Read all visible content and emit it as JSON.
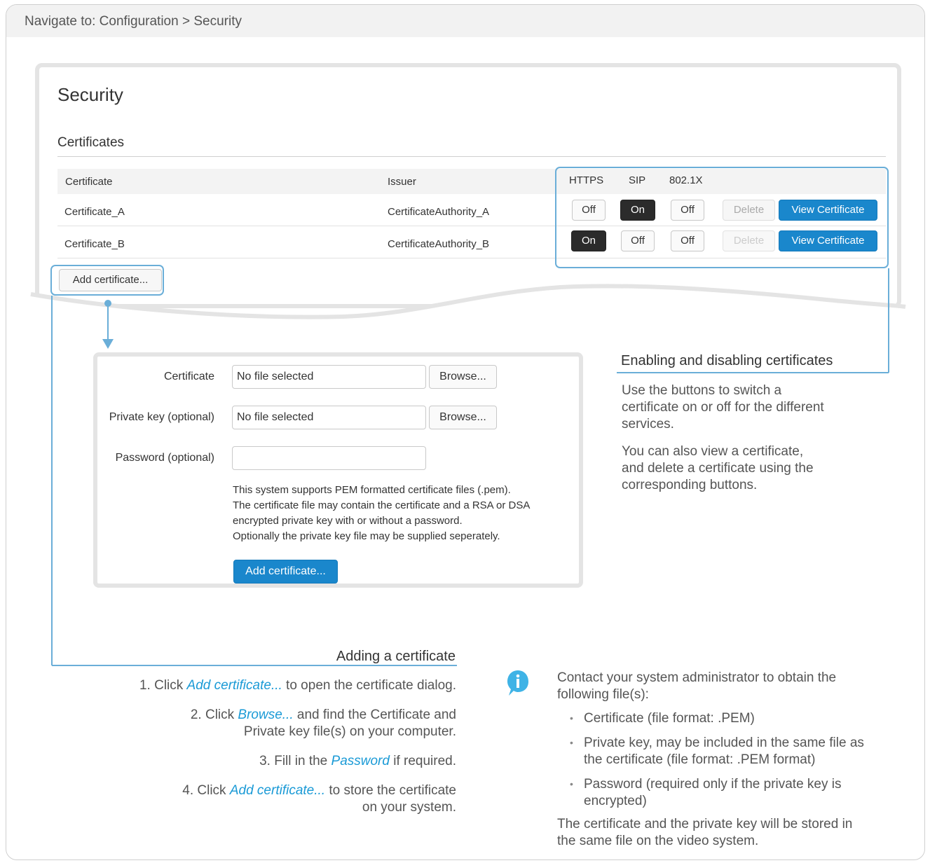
{
  "nav": {
    "text": "Navigate to: Configuration > Security"
  },
  "security": {
    "title": "Security",
    "section": "Certificates",
    "columns": {
      "certificate": "Certificate",
      "issuer": "Issuer",
      "https": "HTTPS",
      "sip": "SIP",
      "dot1x": "802.1X"
    },
    "rows": [
      {
        "name": "Certificate_A",
        "issuer": "CertificateAuthority_A",
        "https": "Off",
        "sip": "On",
        "dot1x": "Off",
        "delete": "Delete",
        "view": "View Certificate"
      },
      {
        "name": "Certificate_B",
        "issuer": "CertificateAuthority_B",
        "https": "On",
        "sip": "Off",
        "dot1x": "Off",
        "delete": "Delete",
        "view": "View Certificate"
      }
    ],
    "add_button": "Add certificate..."
  },
  "dialog": {
    "certificate_label": "Certificate",
    "certificate_value": "No file selected",
    "private_key_label": "Private key (optional)",
    "private_key_value": "No file selected",
    "password_label": "Password (optional)",
    "password_value": "",
    "browse": "Browse...",
    "note": [
      "This system supports PEM formatted certificate files (.pem).",
      "The certificate file may contain the certificate and a RSA or DSA",
      "encrypted private key with or without a password.",
      "Optionally the private key file may be supplied seperately."
    ],
    "add_button": "Add certificate..."
  },
  "enabling": {
    "title": "Enabling and disabling certificates",
    "p1": [
      "Use the buttons to switch a",
      "certificate on or off for the different",
      "services."
    ],
    "p2": [
      "You can also view a certificate,",
      "and delete a certificate using the",
      "corresponding buttons."
    ]
  },
  "adding": {
    "title": "Adding a certificate",
    "step1": {
      "pre": "1.  Click ",
      "em": "Add certificate...",
      "post": " to open the certificate dialog."
    },
    "step2": {
      "pre": "2.  Click ",
      "em": "Browse...",
      "post": " and find the Certificate and",
      "line2": "Private key file(s) on your computer."
    },
    "step3": {
      "pre": "3.  Fill in the ",
      "em": "Password",
      "post": " if required."
    },
    "step4": {
      "pre": "4.  Click ",
      "em": "Add certificate...",
      "post": " to store the certificate",
      "line2": "on your system."
    }
  },
  "info": {
    "intro": [
      "Contact your system administrator to obtain the",
      "following file(s):"
    ],
    "bullets": [
      [
        "Certificate (file format: .PEM)"
      ],
      [
        "Private key, may be included in the same file as",
        "the certificate (file format: .PEM format)"
      ],
      [
        "Password (required only if the private key is",
        "encrypted)"
      ]
    ],
    "outro": [
      "The certificate and the private key will be stored in",
      "the same file on the video system."
    ]
  },
  "colors": {
    "accent": "#1a87cc",
    "highlight": "#6aaed8",
    "link": "#1a9ad6"
  }
}
